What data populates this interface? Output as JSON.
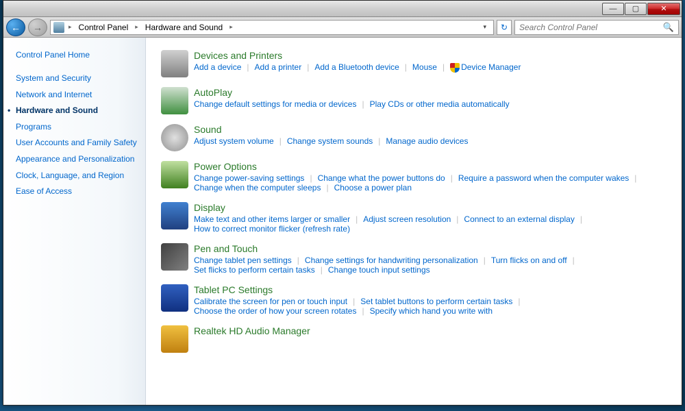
{
  "titlebar": {
    "min": "—",
    "max": "▢",
    "close": "✕"
  },
  "nav": {
    "back": "←",
    "forward": "→"
  },
  "breadcrumb": {
    "items": [
      "Control Panel",
      "Hardware and Sound"
    ],
    "sep": "▸",
    "dropdown": "▾"
  },
  "refresh": "↻",
  "search": {
    "placeholder": "Search Control Panel"
  },
  "sidebar": {
    "home": "Control Panel Home",
    "items": [
      {
        "label": "System and Security",
        "active": false
      },
      {
        "label": "Network and Internet",
        "active": false
      },
      {
        "label": "Hardware and Sound",
        "active": true
      },
      {
        "label": "Programs",
        "active": false
      },
      {
        "label": "User Accounts and Family Safety",
        "active": false
      },
      {
        "label": "Appearance and Personalization",
        "active": false
      },
      {
        "label": "Clock, Language, and Region",
        "active": false
      },
      {
        "label": "Ease of Access",
        "active": false
      }
    ]
  },
  "categories": [
    {
      "icon": "printer",
      "title": "Devices and Printers",
      "links": [
        {
          "label": "Add a device"
        },
        {
          "label": "Add a printer"
        },
        {
          "label": "Add a Bluetooth device"
        },
        {
          "label": "Mouse"
        },
        {
          "label": "Device Manager",
          "shield": true
        }
      ]
    },
    {
      "icon": "autoplay",
      "title": "AutoPlay",
      "links": [
        {
          "label": "Change default settings for media or devices"
        },
        {
          "label": "Play CDs or other media automatically"
        }
      ]
    },
    {
      "icon": "sound",
      "title": "Sound",
      "links": [
        {
          "label": "Adjust system volume"
        },
        {
          "label": "Change system sounds"
        },
        {
          "label": "Manage audio devices"
        }
      ]
    },
    {
      "icon": "power",
      "title": "Power Options",
      "links": [
        {
          "label": "Change power-saving settings"
        },
        {
          "label": "Change what the power buttons do"
        },
        {
          "label": "Require a password when the computer wakes"
        },
        {
          "label": "Change when the computer sleeps"
        },
        {
          "label": "Choose a power plan"
        }
      ]
    },
    {
      "icon": "display",
      "title": "Display",
      "links": [
        {
          "label": "Make text and other items larger or smaller"
        },
        {
          "label": "Adjust screen resolution"
        },
        {
          "label": "Connect to an external display"
        },
        {
          "label": "How to correct monitor flicker (refresh rate)"
        }
      ]
    },
    {
      "icon": "pen",
      "title": "Pen and Touch",
      "links": [
        {
          "label": "Change tablet pen settings"
        },
        {
          "label": "Change settings for handwriting personalization"
        },
        {
          "label": "Turn flicks on and off"
        },
        {
          "label": "Set flicks to perform certain tasks"
        },
        {
          "label": "Change touch input settings"
        }
      ]
    },
    {
      "icon": "tablet",
      "title": "Tablet PC Settings",
      "links": [
        {
          "label": "Calibrate the screen for pen or touch input"
        },
        {
          "label": "Set tablet buttons to perform certain tasks"
        },
        {
          "label": "Choose the order of how your screen rotates"
        },
        {
          "label": "Specify which hand you write with"
        }
      ]
    },
    {
      "icon": "realtek",
      "title": "Realtek HD Audio Manager",
      "links": []
    }
  ],
  "link_sep": "|"
}
